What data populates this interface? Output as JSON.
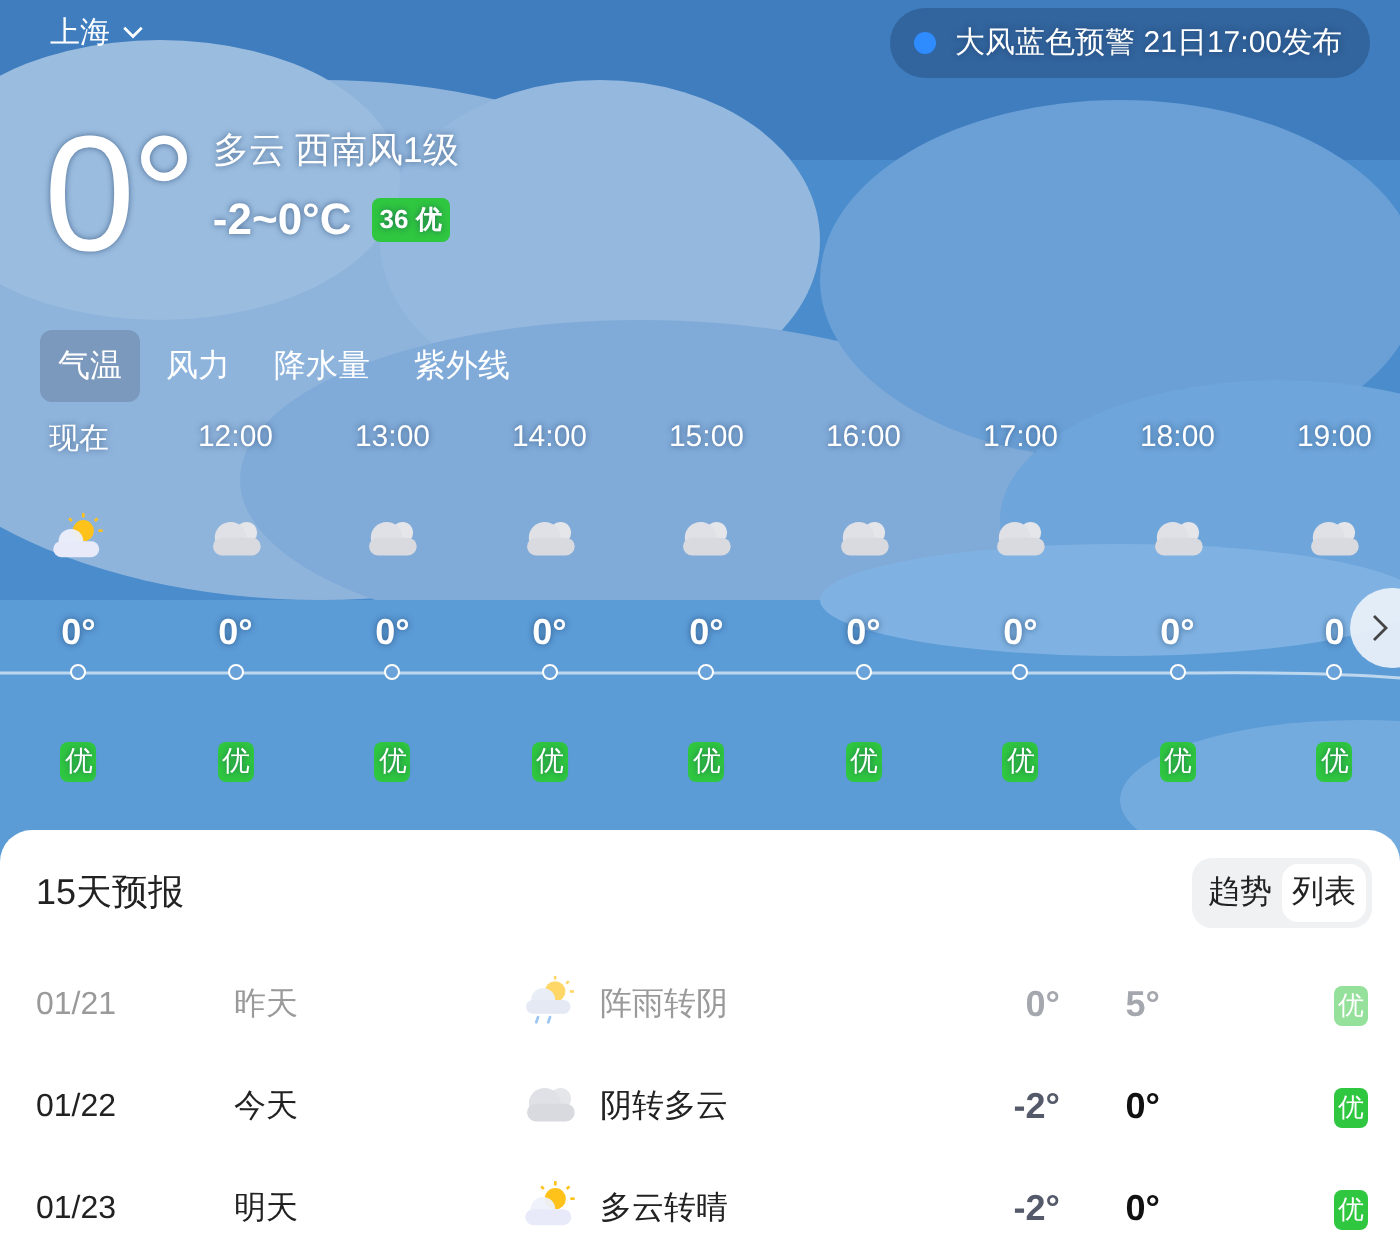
{
  "location": {
    "city": "上海"
  },
  "alert": {
    "text": "大风蓝色预警 21日17:00发布",
    "color": "#2f8cff"
  },
  "current": {
    "temp": "0°",
    "condition": "多云 西南风1级",
    "range": "-2~0°C",
    "aqi": {
      "value": "36 优",
      "color": "#2fc640"
    }
  },
  "tabs": [
    {
      "label": "气温",
      "selected": true
    },
    {
      "label": "风力",
      "selected": false
    },
    {
      "label": "降水量",
      "selected": false
    },
    {
      "label": "紫外线",
      "selected": false
    }
  ],
  "hourly": [
    {
      "time": "现在",
      "kind": "sun-cloud",
      "temp": "0°",
      "aqi": "优"
    },
    {
      "time": "12:00",
      "kind": "cloudy",
      "temp": "0°",
      "aqi": "优"
    },
    {
      "time": "13:00",
      "kind": "cloudy",
      "temp": "0°",
      "aqi": "优"
    },
    {
      "time": "14:00",
      "kind": "cloudy",
      "temp": "0°",
      "aqi": "优"
    },
    {
      "time": "15:00",
      "kind": "cloudy",
      "temp": "0°",
      "aqi": "优"
    },
    {
      "time": "16:00",
      "kind": "cloudy",
      "temp": "0°",
      "aqi": "优"
    },
    {
      "time": "17:00",
      "kind": "cloudy",
      "temp": "0°",
      "aqi": "优"
    },
    {
      "time": "18:00",
      "kind": "cloudy",
      "temp": "0°",
      "aqi": "优"
    },
    {
      "time": "19:00",
      "kind": "cloudy",
      "temp": "0",
      "aqi": "优"
    }
  ],
  "forecast": {
    "title": "15天预报",
    "views": [
      {
        "label": "趋势",
        "selected": false
      },
      {
        "label": "列表",
        "selected": true
      }
    ],
    "days": [
      {
        "date": "01/21",
        "day": "昨天",
        "kind": "shower-sun",
        "condition": "阵雨转阴",
        "low": "0°",
        "high": "5°",
        "aqi": "优",
        "past": true
      },
      {
        "date": "01/22",
        "day": "今天",
        "kind": "cloudy",
        "condition": "阴转多云",
        "low": "-2°",
        "high": "0°",
        "aqi": "优",
        "past": false
      },
      {
        "date": "01/23",
        "day": "明天",
        "kind": "sun-cloud",
        "condition": "多云转晴",
        "low": "-2°",
        "high": "0°",
        "aqi": "优",
        "past": false
      }
    ]
  }
}
